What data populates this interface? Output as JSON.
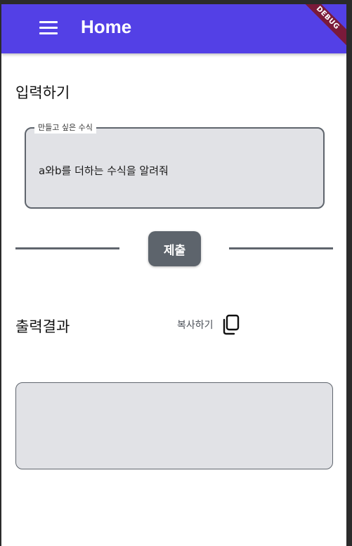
{
  "appbar": {
    "title": "Home",
    "menu_icon": "hamburger-menu-icon",
    "background_color": "#5340e6",
    "debug_label": "DEBUG"
  },
  "input_section": {
    "title": "입력하기",
    "field": {
      "label": "만들고 싶은 수식",
      "value": "a와b를 더하는 수식을 알려줘"
    },
    "submit_label": "제출"
  },
  "output_section": {
    "title": "출력결과",
    "copy_label": "복사하기",
    "copy_icon": "copy-icon",
    "result": ""
  }
}
